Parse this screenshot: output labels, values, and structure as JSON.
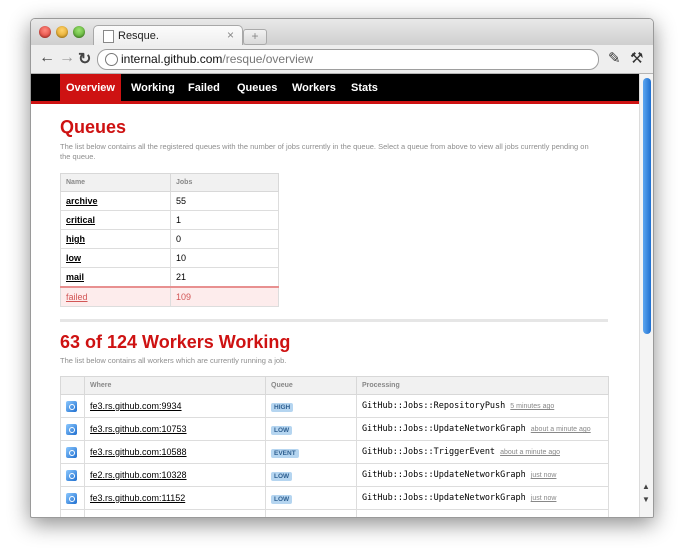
{
  "browser": {
    "tab_title": "Resque.",
    "tab_close": "×",
    "new_tab": "+",
    "url_host": "internal.github.com",
    "url_path": "/resque/overview",
    "back_label": "←",
    "forward_label": "→",
    "reload_label": "↻",
    "page_icon_label": "✎",
    "wrench_icon_label": "⚒"
  },
  "nav": [
    {
      "label": "Overview",
      "active": true
    },
    {
      "label": "Working"
    },
    {
      "label": "Failed"
    },
    {
      "label": "Queues"
    },
    {
      "label": "Workers"
    },
    {
      "label": "Stats"
    }
  ],
  "queues": {
    "title": "Queues",
    "description": "The list below contains all the registered queues with the number of jobs currently in the queue. Select a queue from above to view all jobs currently pending on the queue.",
    "columns": [
      "Name",
      "Jobs"
    ],
    "rows": [
      {
        "name": "archive",
        "jobs": "55"
      },
      {
        "name": "critical",
        "jobs": "1"
      },
      {
        "name": "high",
        "jobs": "0"
      },
      {
        "name": "low",
        "jobs": "10"
      },
      {
        "name": "mail",
        "jobs": "21"
      },
      {
        "name": "failed",
        "jobs": "109",
        "failed": true
      }
    ]
  },
  "workers": {
    "title": "63 of 124 Workers Working",
    "description": "The list below contains all workers which are currently running a job.",
    "columns": [
      "",
      "Where",
      "Queue",
      "Processing"
    ],
    "rows": [
      {
        "where": "fe3.rs.github.com:9934",
        "queue": "HIGH",
        "job": "GitHub::Jobs::RepositoryPush",
        "time": "5 minutes ago"
      },
      {
        "where": "fe3.rs.github.com:10753",
        "queue": "LOW",
        "job": "GitHub::Jobs::UpdateNetworkGraph",
        "time": "about a minute ago"
      },
      {
        "where": "fe3.rs.github.com:10588",
        "queue": "EVENT",
        "job": "GitHub::Jobs::TriggerEvent",
        "time": "about a minute ago"
      },
      {
        "where": "fe2.rs.github.com:10328",
        "queue": "LOW",
        "job": "GitHub::Jobs::UpdateNetworkGraph",
        "time": "just now"
      },
      {
        "where": "fe3.rs.github.com:11152",
        "queue": "LOW",
        "job": "GitHub::Jobs::UpdateNetworkGraph",
        "time": "just now"
      }
    ]
  }
}
